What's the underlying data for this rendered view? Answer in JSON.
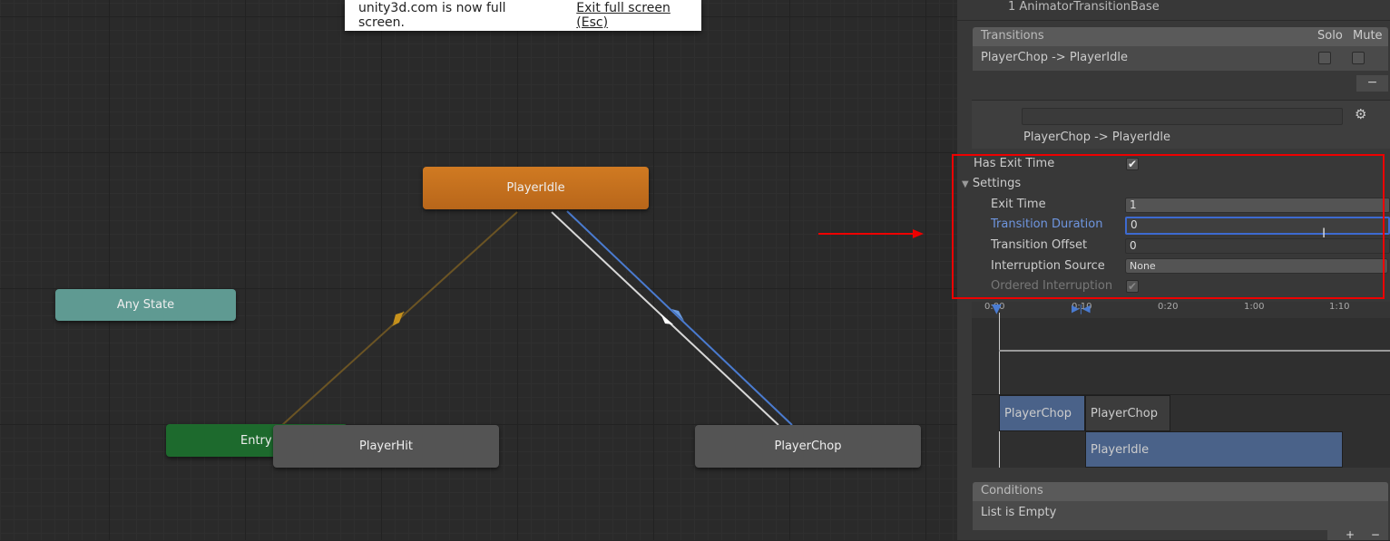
{
  "popup": {
    "message": "unity3d.com is now full screen.",
    "exit_link": "Exit full screen (Esc)"
  },
  "graph": {
    "nodes": {
      "idle": "PlayerIdle",
      "any": "Any State",
      "entry": "Entry",
      "hit": "PlayerHit",
      "chop": "PlayerChop"
    }
  },
  "colors": {
    "idle": "#c7721c",
    "any": "#5f9a92",
    "entry": "#1d6a2d",
    "default": "#555555",
    "highlight": "#e00000",
    "blue": "#4a7bd0"
  },
  "inspector": {
    "title": "1 AnimatorTransitionBase",
    "transitions": {
      "header": "Transitions",
      "solo": "Solo",
      "mute": "Mute",
      "items": [
        {
          "label": "PlayerChop -> PlayerIdle"
        }
      ],
      "remove": "−"
    },
    "name_field": "",
    "subtitle": "PlayerChop -> PlayerIdle",
    "gear_icon": "gear-icon",
    "has_exit_time": {
      "label": "Has Exit Time",
      "checked": true
    },
    "settings": {
      "label": "Settings",
      "exit_time": {
        "label": "Exit Time",
        "value": "1"
      },
      "transition_duration": {
        "label": "Transition Duration",
        "value": "0"
      },
      "transition_offset": {
        "label": "Transition Offset",
        "value": "0"
      },
      "interruption_source": {
        "label": "Interruption Source",
        "value": "None"
      },
      "ordered_interruption": {
        "label": "Ordered Interruption",
        "checked": true
      }
    },
    "timeline": {
      "ticks": [
        "0:00",
        "0:10",
        "0:20",
        "1:00",
        "1:10"
      ],
      "clips": {
        "src1": "PlayerChop",
        "src2": "PlayerChop",
        "dst": "PlayerIdle"
      }
    },
    "conditions": {
      "header": "Conditions",
      "empty": "List is Empty",
      "add": "+",
      "remove": "−"
    }
  }
}
